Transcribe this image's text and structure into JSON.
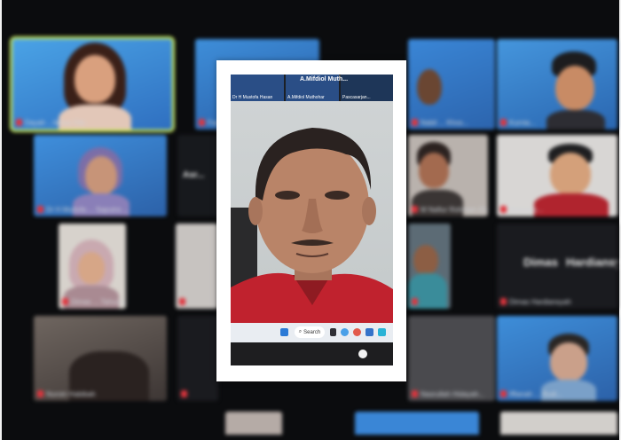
{
  "gallery": {
    "tiles": [
      {
        "label": "Dayah ...fathur Fitri",
        "active": true
      },
      {
        "label": "Fadhil ..."
      },
      {
        "label": "Nabil ... Khos..."
      },
      {
        "label": "Kurnia..."
      },
      {
        "label": "Dr H Mutlofa ... Saputra ... "
      },
      {
        "label": "M Nafiur Rohman (Gaffar)"
      },
      {
        "label": "Antonius..."
      },
      {
        "label": "Dimas ... Tahuryanti..."
      },
      {
        "label": "Nurumal ... Ridwan ..."
      },
      {
        "label": "Inayah Mul..."
      },
      {
        "label": "... Jazyah..."
      },
      {
        "label": "Dimas Hardiansyah"
      },
      {
        "label": "Nuroin Habibah"
      },
      {
        "label": "Nasrullah Hidayah..."
      },
      {
        "label": "Sukari ... Saputra ..."
      },
      {
        "label": "Iffianah ... Budi..."
      }
    ],
    "big_name_1": "Dimas",
    "big_name_2": "Hardiansy",
    "big_name_3": "Asr..."
  },
  "card": {
    "speaker_name": "A.Mifdiol  Muth...",
    "thumbs": [
      {
        "label": "Dr H Mustofa Hasan"
      },
      {
        "label": "A.Mifdiol Muthohar"
      },
      {
        "label": "Pascasarjan..."
      }
    ],
    "taskbar": {
      "search_label": "Search"
    }
  },
  "colors": {
    "active_border": "#c9e85a",
    "tile_blue": "#3a86d6",
    "mic_red": "#e0343d",
    "shirt_red": "#c0222e"
  }
}
